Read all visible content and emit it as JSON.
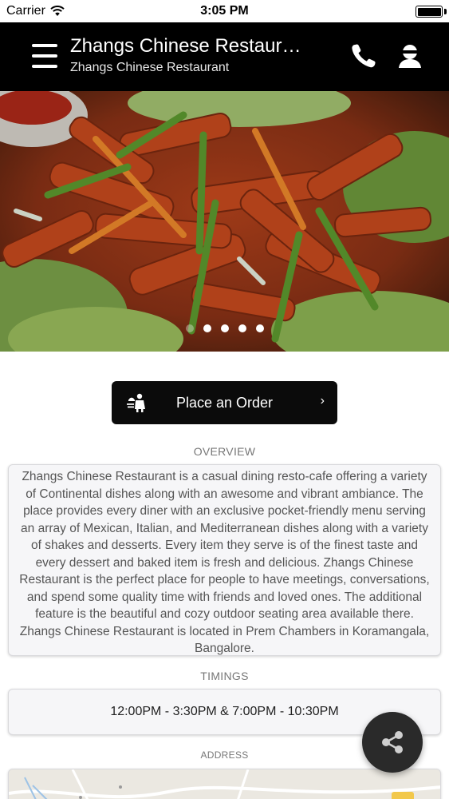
{
  "status_bar": {
    "carrier": "Carrier",
    "time": "3:05 PM",
    "wifi_icon": "wifi-icon",
    "battery_icon": "battery-icon"
  },
  "header": {
    "title": "Zhangs Chinese Restaurant",
    "subtitle": "Zhangs Chinese Restaurant",
    "menu_icon": "hamburger-menu-icon",
    "phone_icon": "phone-icon",
    "profile_icon": "user-profile-icon",
    "background_color": "#000000"
  },
  "carousel": {
    "image_description_icon": "food-photo",
    "slides_total": 5,
    "active_index": 0
  },
  "order_button": {
    "label": "Place an Order",
    "chevron": "›",
    "icon": "waiter-serving-icon"
  },
  "overview": {
    "heading": "OVERVIEW",
    "text": "Zhangs Chinese Restaurant is a casual dining resto-cafe offering a variety of Continental dishes along with an awesome and vibrant ambiance. The place provides every diner with an exclusive pocket-friendly menu serving an array of Mexican, Italian, and Mediterranean dishes along with a variety of shakes and desserts. Every item they serve is of the finest taste and every dessert and baked item is fresh and delicious. Zhangs Chinese Restaurant is the perfect place for people to have meetings, conversations, and spend some quality time with friends and loved ones. The additional feature is the beautiful and cozy outdoor seating area available there. Zhangs Chinese Restaurant is located in Prem Chambers in Koramangala, Bangalore."
  },
  "timings": {
    "heading": "TIMINGS",
    "text": "12:00PM - 3:30PM & 7:00PM - 10:30PM"
  },
  "address": {
    "heading": "ADDRESS"
  },
  "share_button": {
    "icon": "share-icon"
  }
}
